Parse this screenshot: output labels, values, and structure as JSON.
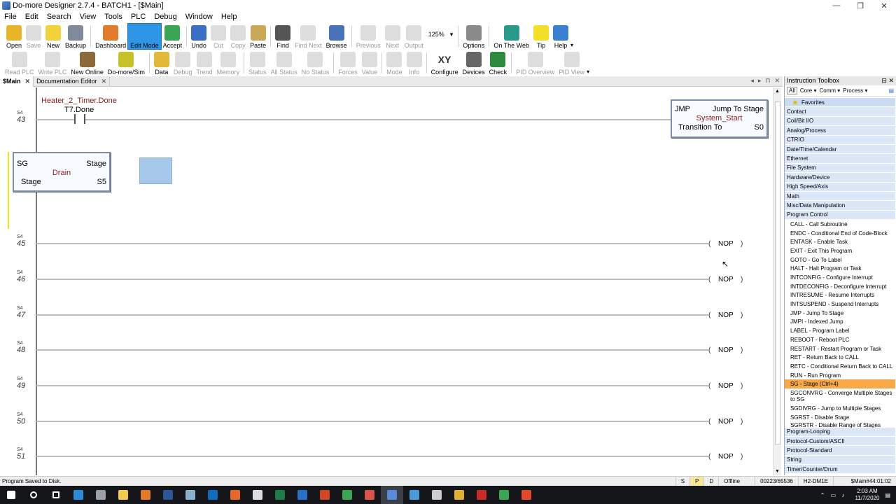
{
  "window": {
    "title": "Do-more Designer 2.7.4 - BATCH1 - [$Main]",
    "controls": [
      "—",
      "❐",
      "✕"
    ]
  },
  "menu": [
    "File",
    "Edit",
    "Search",
    "View",
    "Tools",
    "PLC",
    "Debug",
    "Window",
    "Help"
  ],
  "toolbar1": [
    {
      "name": "open",
      "label": "Open",
      "disabled": false,
      "color": "#e8b52a"
    },
    {
      "name": "save",
      "label": "Save",
      "disabled": true,
      "color": "#cccccc"
    },
    {
      "name": "new",
      "label": "New",
      "disabled": false,
      "color": "#f1d23a"
    },
    {
      "name": "backup",
      "label": "Backup",
      "disabled": false,
      "color": "#7f8a9a"
    },
    {
      "name": "dashboard",
      "label": "Dashboard",
      "disabled": false,
      "color": "#e27b2c"
    },
    {
      "name": "edit-mode",
      "label": "Edit Mode",
      "disabled": false,
      "color": "#2f95e6",
      "active": true
    },
    {
      "name": "accept",
      "label": "Accept",
      "disabled": false,
      "color": "#3aa655"
    },
    {
      "name": "undo",
      "label": "Undo",
      "disabled": false,
      "color": "#3b6fc4"
    },
    {
      "name": "cut",
      "label": "Cut",
      "disabled": true,
      "color": "#cccccc"
    },
    {
      "name": "copy",
      "label": "Copy",
      "disabled": true,
      "color": "#cccccc"
    },
    {
      "name": "paste",
      "label": "Paste",
      "disabled": false,
      "color": "#c9a85a"
    },
    {
      "name": "find",
      "label": "Find",
      "disabled": false,
      "color": "#555555"
    },
    {
      "name": "find-next",
      "label": "Find Next",
      "disabled": true,
      "color": "#cccccc"
    },
    {
      "name": "browse",
      "label": "Browse",
      "disabled": false,
      "color": "#4a72b8"
    },
    {
      "name": "previous",
      "label": "Previous",
      "disabled": true,
      "color": "#cccccc"
    },
    {
      "name": "next",
      "label": "Next",
      "disabled": true,
      "color": "#cccccc"
    },
    {
      "name": "output",
      "label": "Output",
      "disabled": true,
      "color": "#cccccc"
    },
    {
      "name": "options",
      "label": "Options",
      "disabled": false,
      "color": "#8a8a8a"
    },
    {
      "name": "on-the-web",
      "label": "On The Web",
      "disabled": false,
      "color": "#2a9a8a"
    },
    {
      "name": "tip",
      "label": "Tip",
      "disabled": false,
      "color": "#f2df2a"
    },
    {
      "name": "help",
      "label": "Help",
      "disabled": false,
      "color": "#3a7fd0"
    }
  ],
  "zoom": "125%",
  "toolbar2": [
    {
      "name": "read-plc",
      "label": "Read PLC",
      "disabled": true,
      "color": "#cccccc"
    },
    {
      "name": "write-plc",
      "label": "Write PLC",
      "disabled": true,
      "color": "#cccccc"
    },
    {
      "name": "new-online",
      "label": "New Online",
      "disabled": false,
      "color": "#8a6a3a"
    },
    {
      "name": "do-more-sim",
      "label": "Do-more/Sim",
      "disabled": false,
      "color": "#c8c22a"
    },
    {
      "name": "data",
      "label": "Data",
      "disabled": false,
      "color": "#e3b73a"
    },
    {
      "name": "debug",
      "label": "Debug",
      "disabled": true,
      "color": "#cccccc"
    },
    {
      "name": "trend",
      "label": "Trend",
      "disabled": true,
      "color": "#cccccc"
    },
    {
      "name": "memory",
      "label": "Memory",
      "disabled": true,
      "color": "#cccccc"
    },
    {
      "name": "status",
      "label": "Status",
      "disabled": true,
      "color": "#cccccc"
    },
    {
      "name": "all-status",
      "label": "All Status",
      "disabled": true,
      "color": "#cccccc"
    },
    {
      "name": "no-status",
      "label": "No Status",
      "disabled": true,
      "color": "#cccccc"
    },
    {
      "name": "forces",
      "label": "Forces",
      "disabled": true,
      "color": "#cccccc"
    },
    {
      "name": "value",
      "label": "Value",
      "disabled": true,
      "color": "#cccccc"
    },
    {
      "name": "mode",
      "label": "Mode",
      "disabled": true,
      "color": "#cccccc"
    },
    {
      "name": "info",
      "label": "Info",
      "disabled": true,
      "color": "#cccccc"
    },
    {
      "name": "configure",
      "label": "Configure",
      "disabled": false,
      "color": "#333333",
      "glyph": "XY"
    },
    {
      "name": "devices",
      "label": "Devices",
      "disabled": false,
      "color": "#666666"
    },
    {
      "name": "check",
      "label": "Check",
      "disabled": false,
      "color": "#2e8a3e"
    },
    {
      "name": "pid-overview",
      "label": "PID Overview",
      "disabled": true,
      "color": "#cccccc"
    },
    {
      "name": "pid-view",
      "label": "PID View",
      "disabled": true,
      "color": "#cccccc"
    }
  ],
  "tabs": [
    {
      "label": "$Main",
      "current": true
    },
    {
      "label": "Documentation Editor",
      "current": false
    }
  ],
  "ladder": {
    "contact": {
      "nickname": "Heater_2_Timer.Done",
      "address": "T7.Done"
    },
    "jmp": {
      "tl": "JMP",
      "tr": "Jump To Stage",
      "mid": "System_Start",
      "bl": "Transition To",
      "br": "S0"
    },
    "sg": {
      "tl": "SG",
      "tr": "Stage",
      "mid": "Drain",
      "bl": "Stage",
      "br": "S5"
    },
    "stage_prefix": "S4",
    "rungs": [
      {
        "num": "43",
        "nop": ""
      },
      {
        "num": "45",
        "nop": "NOP"
      },
      {
        "num": "46",
        "nop": "NOP"
      },
      {
        "num": "47",
        "nop": "NOP"
      },
      {
        "num": "48",
        "nop": "NOP"
      },
      {
        "num": "49",
        "nop": "NOP"
      },
      {
        "num": "50",
        "nop": "NOP"
      },
      {
        "num": "51",
        "nop": "NOP"
      }
    ]
  },
  "toolbox": {
    "title": "Instruction Toolbox",
    "filter": {
      "all": "All",
      "core": "Core ▾",
      "comm": "Comm ▾",
      "process": "Process ▾"
    },
    "favorites": "Favorites",
    "categories_top": [
      "Contact",
      "Coil/Bit I/O",
      "Analog/Process",
      "CTRIO",
      "Date/Time/Calendar",
      "Ethernet",
      "File System",
      "Hardware/Device",
      "High Speed/Axis",
      "Math",
      "Misc/Data Manipulation",
      "Program Control"
    ],
    "items": [
      "CALL - Call Subroutine",
      "ENDC - Conditional End of Code-Block",
      "ENTASK - Enable Task",
      "EXIT - Exit This Program",
      "GOTO - Go To Label",
      "HALT - Halt Program or Task",
      "INTCONFIG - Configure Interrupt",
      "INTDECONFIG - Deconfigure Interrupt",
      "INTRESUME - Resume Interrupts",
      "INTSUSPEND - Suspend Interrupts",
      "JMP - Jump To Stage",
      "JMPI - Indexed Jump",
      "LABEL - Program Label",
      "REBOOT - Reboot PLC",
      "RESTART - Restart Program or Task",
      "RET - Return Back to CALL",
      "RETC - Conditional Return Back to CALL",
      "RUN - Run Program",
      "SG - Stage (Ctrl+4)",
      "SGCONVRG - Converge Multiple Stages to SG",
      "SGDIVRG - Jump to Multiple Stages",
      "SGRST - Disable Stage",
      "SGRSTR - Disable Range of Stages"
    ],
    "selected_index": 18,
    "categories_bottom": [
      "Program-Looping",
      "Protocol-Custom/ASCII",
      "Protocol-Standard",
      "String",
      "Timer/Counter/Drum"
    ]
  },
  "status": {
    "left": "Program Saved to Disk.",
    "s": "S",
    "p": "P",
    "d": "D",
    "mode": "Offline",
    "memory": "00223/65536",
    "cpu": "H2-DM1E",
    "position": "$Main#44:01:02"
  },
  "taskbar": {
    "icons": [
      {
        "name": "windows-start-icon",
        "color": "#ffffff"
      },
      {
        "name": "search-icon",
        "color": "#ffffff"
      },
      {
        "name": "task-view-icon",
        "color": "#ffffff"
      },
      {
        "name": "edge-icon",
        "color": "#2a8ad6"
      },
      {
        "name": "app-icon",
        "color": "#9aa0a8"
      },
      {
        "name": "file-explorer-icon",
        "color": "#f2c94c"
      },
      {
        "name": "forms-icon",
        "color": "#e07b2a"
      },
      {
        "name": "word-icon",
        "color": "#2b5797"
      },
      {
        "name": "app2-icon",
        "color": "#8ab0d0"
      },
      {
        "name": "outlook-icon",
        "color": "#0f6cbd"
      },
      {
        "name": "firefox-icon",
        "color": "#e66a2a"
      },
      {
        "name": "tools-icon",
        "color": "#dddddd"
      },
      {
        "name": "excel-icon",
        "color": "#1f7a45"
      },
      {
        "name": "project-icon",
        "color": "#2b6fc4"
      },
      {
        "name": "powerpoint-icon",
        "color": "#d24726"
      },
      {
        "name": "camtasia-icon",
        "color": "#3aa655"
      },
      {
        "name": "app3-icon",
        "color": "#d9534f"
      },
      {
        "name": "domore-icon",
        "color": "#5a8ad6"
      },
      {
        "name": "app4-icon",
        "color": "#4a9ad6"
      },
      {
        "name": "app5-icon",
        "color": "#cccccc"
      },
      {
        "name": "chrome-icon",
        "color": "#e0b030"
      },
      {
        "name": "acrobat-icon",
        "color": "#c92a2a"
      },
      {
        "name": "app6-icon",
        "color": "#3aa655"
      },
      {
        "name": "app7-icon",
        "color": "#e04a2a"
      }
    ],
    "time": "2:03 AM",
    "date": "11/7/2020"
  },
  "colors": {
    "nickname": "#8b1a1a",
    "active": "#2f95e6",
    "selected": "#f7a948",
    "category": "#dbe7f7"
  }
}
